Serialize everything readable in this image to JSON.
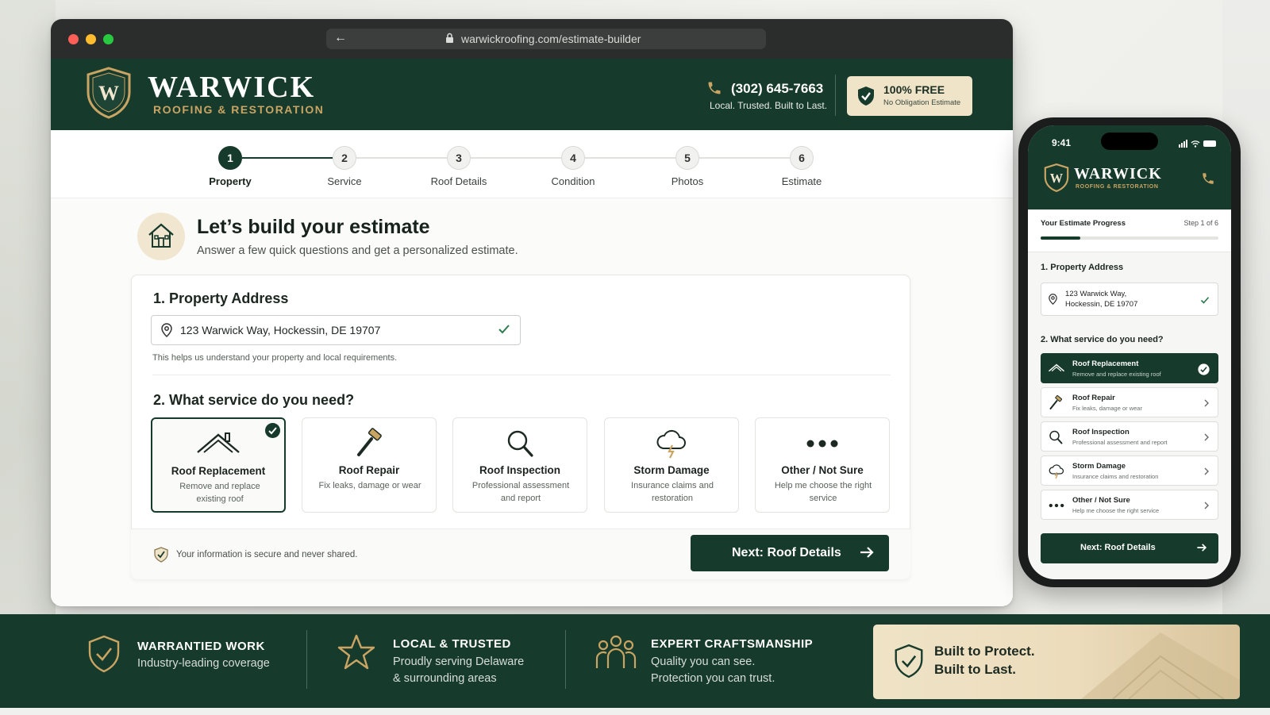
{
  "browser": {
    "url": "warwickroofing.com/estimate-builder"
  },
  "brand": {
    "name": "WARWICK",
    "subtitle": "ROOFING & RESTORATION",
    "monogram": "W",
    "phone": "(302) 645-7663",
    "tagline": "Local. Trusted. Built to Last.",
    "free_title": "100% FREE",
    "free_sub": "No Obligation Estimate",
    "primary_color": "#163a2c",
    "accent_color": "#c9a463"
  },
  "stepper": {
    "current": 1,
    "steps": [
      {
        "num": "1",
        "label": "Property"
      },
      {
        "num": "2",
        "label": "Service"
      },
      {
        "num": "3",
        "label": "Roof Details"
      },
      {
        "num": "4",
        "label": "Condition"
      },
      {
        "num": "5",
        "label": "Photos"
      },
      {
        "num": "6",
        "label": "Estimate"
      }
    ]
  },
  "hero": {
    "title": "Let’s build your estimate",
    "subtitle": "Answer a few quick questions and get a personalized estimate."
  },
  "form": {
    "address_title": "1. Property Address",
    "address_value": "123 Warwick Way, Hockessin, DE 19707",
    "address_helper": "This helps us understand your property and local requirements.",
    "service_title": "2. What service do you need?",
    "services": [
      {
        "icon": "roof-icon",
        "title": "Roof Replacement",
        "desc": "Remove and replace existing roof",
        "selected": true
      },
      {
        "icon": "hammer-icon",
        "title": "Roof Repair",
        "desc": "Fix leaks, damage or wear",
        "selected": false
      },
      {
        "icon": "magnifier-icon",
        "title": "Roof Inspection",
        "desc": "Professional assessment and report",
        "selected": false
      },
      {
        "icon": "storm-cloud-icon",
        "title": "Storm Damage",
        "desc": "Insurance claims and restoration",
        "selected": false
      },
      {
        "icon": "more-dots-icon",
        "title": "Other / Not Sure",
        "desc": "Help me choose the right service",
        "selected": false
      }
    ],
    "secure_note": "Your information is secure and never shared.",
    "next_label": "Next: Roof Details"
  },
  "mobile": {
    "time": "9:41",
    "progress_label": "Your Estimate Progress",
    "progress_step": "Step 1 of 6",
    "progress_fraction": 0.2222,
    "address_title": "1. Property Address",
    "address_line1": "123 Warwick Way,",
    "address_line2": "Hockessin, DE 19707",
    "service_title": "2. What service do you need?",
    "services": [
      {
        "title": "Roof Replacement",
        "desc": "Remove and replace existing roof"
      },
      {
        "title": "Roof Repair",
        "desc": "Fix leaks, damage or wear"
      },
      {
        "title": "Roof Inspection",
        "desc": "Professional assessment and report"
      },
      {
        "title": "Storm Damage",
        "desc": "Insurance claims and restoration"
      },
      {
        "title": "Other / Not Sure",
        "desc": "Help me choose the right service"
      }
    ],
    "next_label": "Next: Roof Details"
  },
  "features": [
    {
      "icon": "shield-check-icon",
      "title": "WARRANTIED WORK",
      "line1": "Industry-leading coverage",
      "line2": ""
    },
    {
      "icon": "star-icon",
      "title": "LOCAL & TRUSTED",
      "line1": "Proudly serving Delaware",
      "line2": "& surrounding areas"
    },
    {
      "icon": "team-icon",
      "title": "EXPERT CRAFTSMANSHIP",
      "line1": "Quality you can see.",
      "line2": "Protection you can trust."
    }
  ],
  "promo": {
    "line1": "Built to Protect.",
    "line2": "Built to Last."
  }
}
